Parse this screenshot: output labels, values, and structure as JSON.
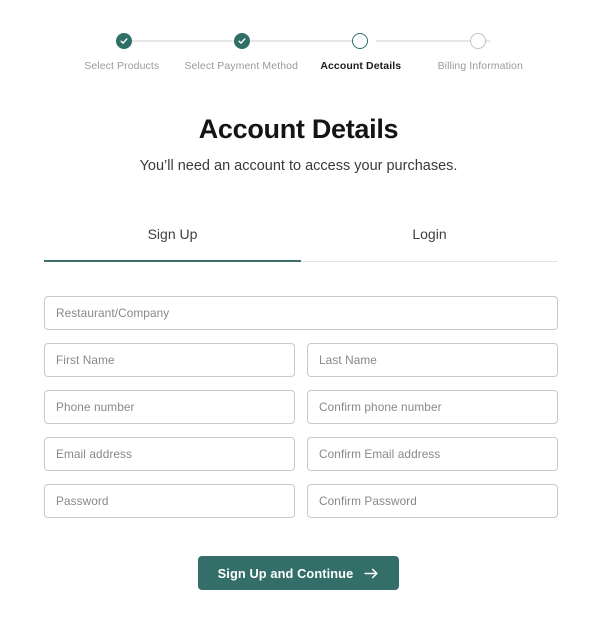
{
  "stepper": {
    "steps": [
      {
        "label": "Select Products",
        "state": "done",
        "icon": "check-icon"
      },
      {
        "label": "Select Payment Method",
        "state": "done",
        "icon": "check-icon"
      },
      {
        "label": "Account Details",
        "state": "current",
        "icon": "circle-icon"
      },
      {
        "label": "Billing Information",
        "state": "todo",
        "icon": "circle-icon"
      }
    ],
    "accent_color": "#2f6f68",
    "inactive_color": "#c2c2c2",
    "label_color": "#9a9a9a",
    "active_label_color": "#1b1b1b"
  },
  "header": {
    "title": "Account Details",
    "subtitle": "You’ll need an account to access your purchases."
  },
  "tabs": [
    {
      "label": "Sign Up",
      "active": true
    },
    {
      "label": "Login",
      "active": false
    }
  ],
  "tab_underline_color": "#3c6f69",
  "form": {
    "rows": [
      [
        {
          "name": "company",
          "placeholder": "Restaurant/Company",
          "value": ""
        }
      ],
      [
        {
          "name": "first-name",
          "placeholder": "First Name",
          "value": ""
        },
        {
          "name": "last-name",
          "placeholder": "Last Name",
          "value": ""
        }
      ],
      [
        {
          "name": "phone",
          "placeholder": "Phone number",
          "value": ""
        },
        {
          "name": "confirm-phone",
          "placeholder": "Confirm phone number",
          "value": ""
        }
      ],
      [
        {
          "name": "email",
          "placeholder": "Email address",
          "value": ""
        },
        {
          "name": "confirm-email",
          "placeholder": "Confirm Email address",
          "value": ""
        }
      ],
      [
        {
          "name": "password",
          "placeholder": "Password",
          "value": ""
        },
        {
          "name": "confirm-password",
          "placeholder": "Confirm Password",
          "value": ""
        }
      ]
    ]
  },
  "submit": {
    "label": "Sign Up and Continue",
    "icon": "arrow-right-icon",
    "background_color": "#336f68",
    "text_color": "#ffffff"
  }
}
